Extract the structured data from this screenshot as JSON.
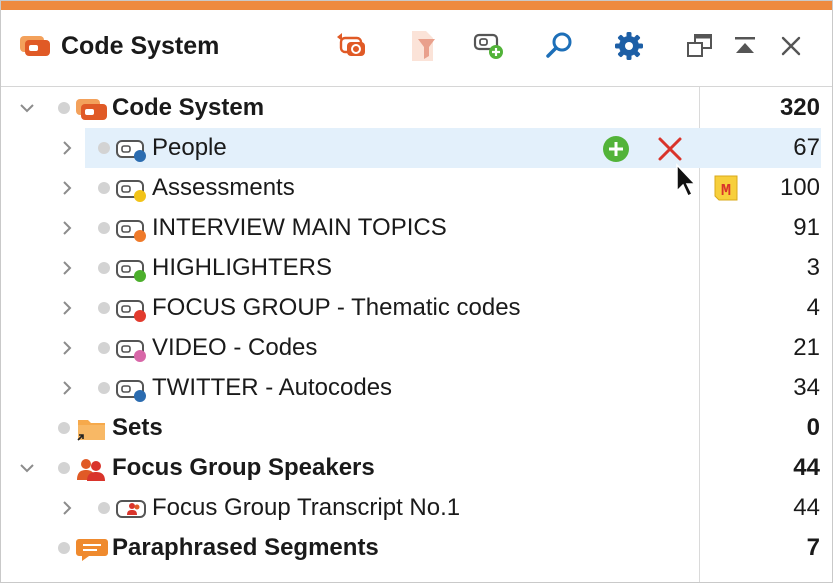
{
  "window": {
    "title": "Code System",
    "accent_color": "#ee8a3f",
    "toolbar": [
      {
        "name": "undo-activate-icon"
      },
      {
        "name": "filter-document-icon"
      },
      {
        "name": "new-code-icon"
      },
      {
        "name": "search-icon"
      },
      {
        "name": "gear-icon"
      },
      {
        "name": "undock-window-icon"
      },
      {
        "name": "maximize-icon"
      },
      {
        "name": "close-icon"
      }
    ]
  },
  "tree": {
    "root": {
      "label": "Code System",
      "count": "320"
    },
    "codes": [
      {
        "label": "People",
        "count": "67",
        "color": "#2b6cb0",
        "selected": true
      },
      {
        "label": "Assessments",
        "count": "100",
        "color": "#f2c318"
      },
      {
        "label": "INTERVIEW MAIN TOPICS",
        "count": "91",
        "color": "#ef7a2a"
      },
      {
        "label": "HIGHLIGHTERS",
        "count": "3",
        "color": "#4caf2c"
      },
      {
        "label": "FOCUS GROUP - Thematic codes",
        "count": "4",
        "color": "#e23b2e"
      },
      {
        "label": "VIDEO - Codes",
        "count": "21",
        "color": "#d867a8"
      },
      {
        "label": "TWITTER - Autocodes",
        "count": "34",
        "color": "#2b6cb0"
      }
    ],
    "sets": {
      "label": "Sets",
      "count": "0"
    },
    "speakers": {
      "label": "Focus Group Speakers",
      "count": "44"
    },
    "transcript": {
      "label": "Focus Group Transcript No.1",
      "count": "44"
    },
    "paraphrased": {
      "label": "Paraphrased Segments",
      "count": "7"
    },
    "memo_badge": "M"
  }
}
